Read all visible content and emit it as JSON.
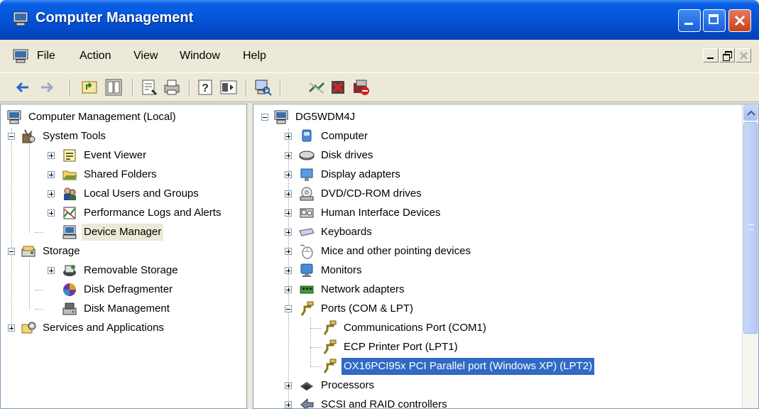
{
  "window": {
    "title": "Computer Management"
  },
  "menu": [
    "File",
    "Action",
    "View",
    "Window",
    "Help"
  ],
  "toolbar": [
    "back-icon",
    "forward-icon",
    "up-level-icon",
    "show-hide-tree-icon",
    "properties-icon",
    "print-icon",
    "help-icon",
    "show-hide-action-pane-icon",
    "scan-hardware-icon",
    "update-driver-icon",
    "uninstall-icon",
    "disable-icon"
  ],
  "left_tree": [
    {
      "label": "Computer Management (Local)",
      "icon": "computer-management-icon"
    },
    {
      "label": "System Tools",
      "icon": "system-tools-icon"
    },
    {
      "label": "Event Viewer",
      "icon": "event-viewer-icon"
    },
    {
      "label": "Shared Folders",
      "icon": "folder-icon"
    },
    {
      "label": "Local Users and Groups",
      "icon": "users-icon"
    },
    {
      "label": "Performance Logs and Alerts",
      "icon": "performance-icon"
    },
    {
      "label": "Device Manager",
      "icon": "device-manager-icon"
    },
    {
      "label": "Storage",
      "icon": "storage-icon"
    },
    {
      "label": "Removable Storage",
      "icon": "removable-storage-icon"
    },
    {
      "label": "Disk Defragmenter",
      "icon": "defragmenter-icon"
    },
    {
      "label": "Disk Management",
      "icon": "disk-management-icon"
    },
    {
      "label": "Services and Applications",
      "icon": "services-icon"
    }
  ],
  "right_tree": [
    {
      "label": "DG5WDM4J",
      "icon": "computer-icon"
    },
    {
      "label": "Computer",
      "icon": "computer-icon"
    },
    {
      "label": "Disk drives",
      "icon": "disk-drive-icon"
    },
    {
      "label": "Display adapters",
      "icon": "display-adapter-icon"
    },
    {
      "label": "DVD/CD-ROM drives",
      "icon": "dvd-drive-icon"
    },
    {
      "label": "Human Interface Devices",
      "icon": "hid-icon"
    },
    {
      "label": "Keyboards",
      "icon": "keyboard-icon"
    },
    {
      "label": "Mice and other pointing devices",
      "icon": "mouse-icon"
    },
    {
      "label": "Monitors",
      "icon": "monitor-icon"
    },
    {
      "label": "Network adapters",
      "icon": "network-adapter-icon"
    },
    {
      "label": "Ports (COM & LPT)",
      "icon": "port-icon"
    },
    {
      "label": "Communications Port (COM1)",
      "icon": "port-icon"
    },
    {
      "label": "ECP Printer Port (LPT1)",
      "icon": "port-icon"
    },
    {
      "label": "OX16PCI95x PCI Parallel port (Windows XP) (LPT2)",
      "icon": "port-icon"
    },
    {
      "label": "Processors",
      "icon": "processor-icon"
    },
    {
      "label": "SCSI and RAID controllers",
      "icon": "scsi-icon"
    }
  ]
}
